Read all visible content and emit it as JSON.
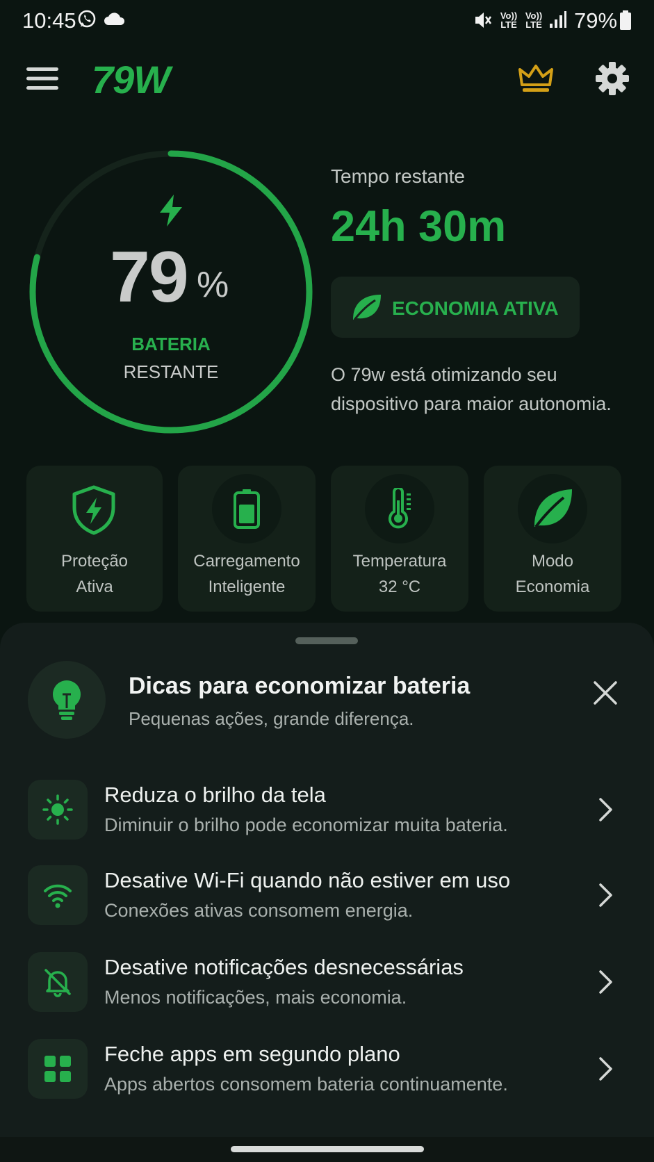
{
  "status_bar": {
    "time": "10:45",
    "battery_percent": "79%",
    "icons": [
      "whatsapp-icon",
      "cloud-icon",
      "mute-icon",
      "volte-icon",
      "volte-icon",
      "signal-icon",
      "battery-icon"
    ]
  },
  "header": {
    "brand": "79W",
    "icons": [
      "menu-icon",
      "crown-icon",
      "gear-icon"
    ]
  },
  "battery": {
    "level": 0.79,
    "percent_number": "79",
    "percent_sign": "%",
    "label_line1": "BATERIA",
    "label_line2": "RESTANTE"
  },
  "time_left": {
    "label": "Tempo restante",
    "value": "24h 30m"
  },
  "eco_badge": {
    "label": "ECONOMIA ATIVA",
    "icon": "leaf-icon"
  },
  "info_text": "O 79w está otimizando seu dispositivo para maior autonomia.",
  "features": [
    {
      "line1": "Proteção",
      "line2": "Ativa",
      "icon": "shield-bolt-icon"
    },
    {
      "line1": "Carregamento",
      "line2": "Inteligente",
      "icon": "battery-icon"
    },
    {
      "line1": "Temperatura",
      "line2": "32 °C",
      "icon": "thermometer-icon"
    },
    {
      "line1": "Modo",
      "line2": "Economia",
      "icon": "leaf-icon"
    }
  ],
  "tips": {
    "title": "Dicas para economizar bateria",
    "subtitle": "Pequenas ações, grande diferença.",
    "header_icon": "lightbulb-icon",
    "items": [
      {
        "title": "Reduza o brilho da tela",
        "description": "Diminuir o brilho pode economizar muita bateria.",
        "icon": "brightness-icon"
      },
      {
        "title": "Desative Wi-Fi quando não estiver em uso",
        "description": "Conexões ativas consomem energia.",
        "icon": "wifi-icon"
      },
      {
        "title": "Desative notificações desnecessárias",
        "description": "Menos notificações, mais economia.",
        "icon": "bell-off-icon"
      },
      {
        "title": "Feche apps em segundo plano",
        "description": "Apps abertos consomem bateria continuamente.",
        "icon": "apps-grid-icon"
      }
    ]
  },
  "colors": {
    "background": "#0b1511",
    "accent_green": "#27b04d",
    "crown_gold": "#d4a017",
    "sheet": "#141d1b"
  }
}
